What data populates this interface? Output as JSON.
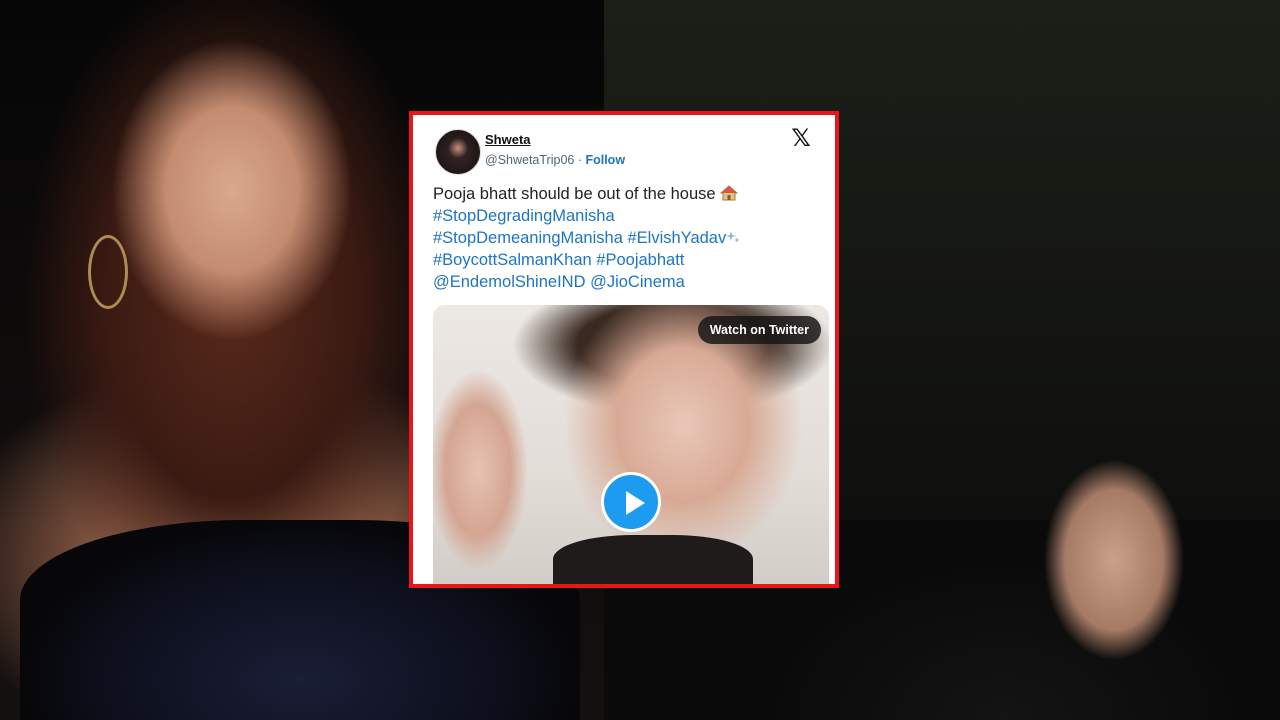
{
  "tweet": {
    "display_name": "Shweta",
    "handle": "@ShwetaTrip06",
    "separator": " · ",
    "follow_label": "Follow",
    "x_logo": "𝕏",
    "text_line": "Pooja bhatt should be out of the house",
    "hashtags_line1": "#StopDegradingManisha",
    "hashtags_line2a": "#StopDemeaningManisha",
    "hashtags_line2b": "#ElvishYadav",
    "hashtags_line3a": "#BoycottSalmanKhan",
    "hashtags_line3b": "#Poojabhatt",
    "mention_a": "@EndemolShineIND",
    "mention_b": "@JioCinema",
    "media": {
      "watch_label": "Watch on Twitter"
    }
  },
  "colors": {
    "frame_border": "#e8161b",
    "link_blue": "#1d74c5",
    "play_blue": "#1d9bf0"
  },
  "icons": {
    "avatar": "avatar",
    "x_logo": "x-logo-icon",
    "house": "house-emoji-icon",
    "sparkle": "sparkle-emoji-icon",
    "play": "play-icon"
  }
}
